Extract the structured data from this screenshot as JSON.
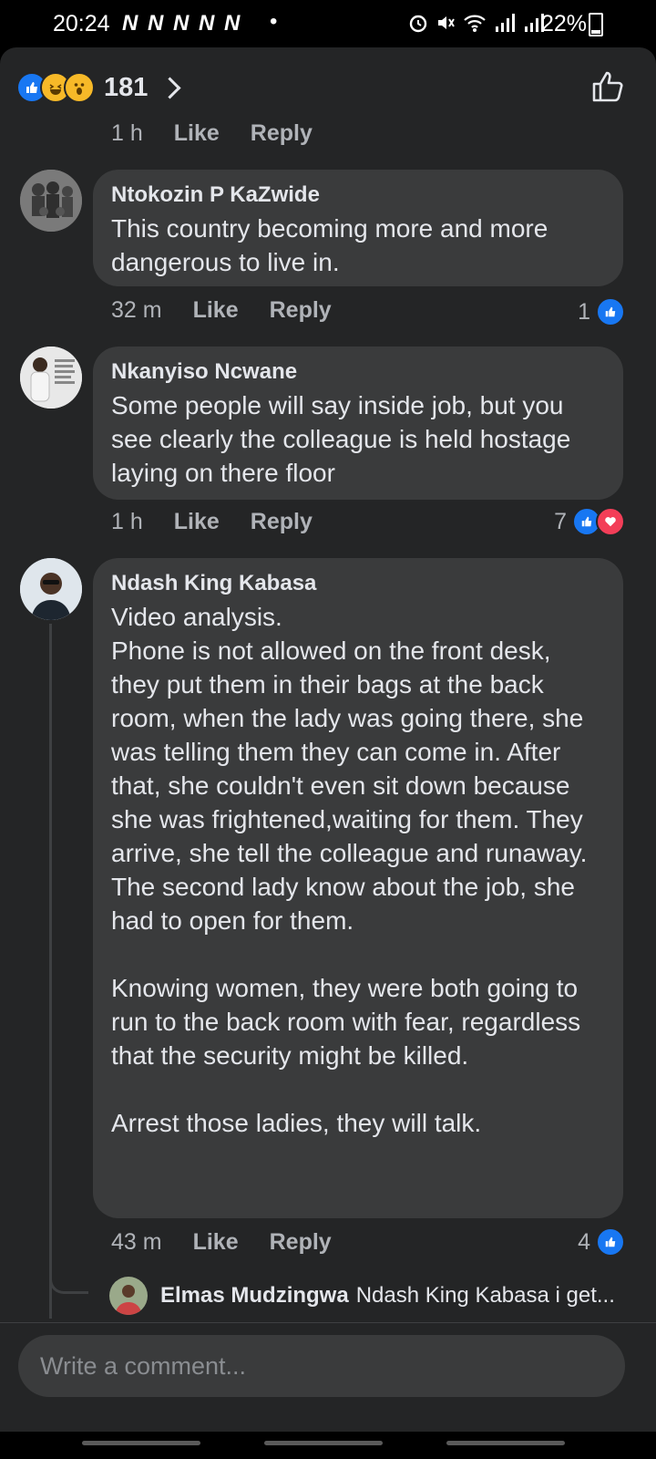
{
  "status_bar": {
    "time": "20:24",
    "notifications": "N N N N N",
    "dot": "•",
    "battery": "22%"
  },
  "reactions": {
    "count": "181",
    "types": [
      "like-icon",
      "haha-icon",
      "wow-icon"
    ]
  },
  "top_meta": {
    "time": "1 h",
    "like": "Like",
    "reply": "Reply"
  },
  "comments": [
    {
      "author": "Ntokozin P KaZwide",
      "text": "This country becoming more and more dangerous to live in.",
      "time": "32 m",
      "like": "Like",
      "reply": "Reply",
      "reaction_count": "1"
    },
    {
      "author": "Nkanyiso Ncwane",
      "text": "Some people will say inside job, but you see clearly the colleague is held hostage laying on there floor",
      "time": "1 h",
      "like": "Like",
      "reply": "Reply",
      "reaction_count": "7"
    },
    {
      "author": "Ndash King Kabasa",
      "text": "Video analysis.\nPhone is not allowed on the front desk, they put them in their bags at the back room, when the lady was going there, she was telling them they can come in. After that, she couldn't even sit down because she was frightened,waiting for them. They arrive, she tell the colleague and runaway.\nThe second lady know about the job, she had to open for them.\n\nKnowing women, they were both going to run to the back room with fear, regardless that the security might be killed.\n\nArrest those ladies, they will talk.",
      "time": "43 m",
      "like": "Like",
      "reply": "Reply",
      "reaction_count": "4"
    }
  ],
  "reply_preview": {
    "author": "Elmas Mudzingwa",
    "text": "Ndash King Kabasa i get..."
  },
  "composer": {
    "placeholder": "Write a comment..."
  },
  "colors": {
    "background": "#242526",
    "bubble": "#3a3b3c",
    "like_blue": "#1877f2",
    "love_red": "#f33e58",
    "secondary_text": "#b0b3b8"
  }
}
